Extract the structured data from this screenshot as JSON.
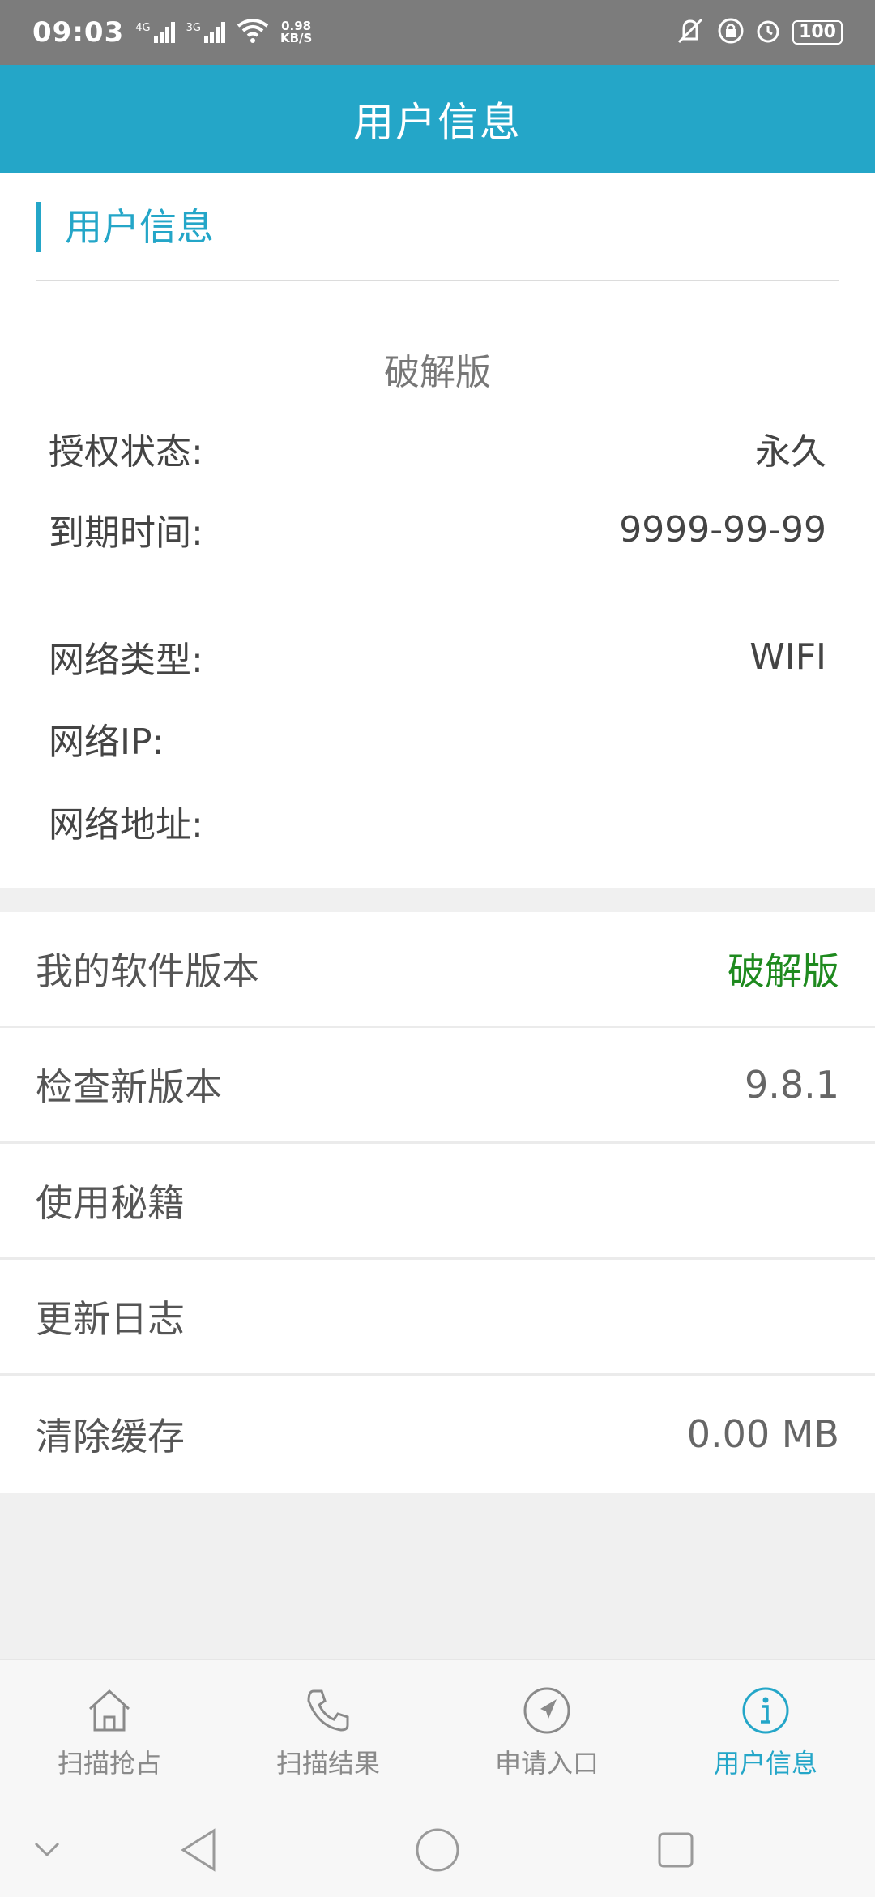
{
  "status_bar": {
    "time": "09:03",
    "sim1": "4G",
    "sim2": "3G",
    "speed_value": "0.98",
    "speed_unit": "KB/S",
    "battery": "100"
  },
  "header": {
    "title": "用户信息"
  },
  "user_info": {
    "section_title": "用户信息",
    "version_label": "破解版",
    "auth_status_label": "授权状态:",
    "auth_status_value": "永久",
    "expiry_label": "到期时间:",
    "expiry_value": "9999-99-99",
    "net_type_label": "网络类型:",
    "net_type_value": "WIFI",
    "net_ip_label": "网络IP:",
    "net_ip_value": "",
    "net_addr_label": "网络地址:",
    "net_addr_value": ""
  },
  "settings": [
    {
      "label": "我的软件版本",
      "value": "破解版"
    },
    {
      "label": "检查新版本",
      "value": "9.8.1"
    },
    {
      "label": "使用秘籍",
      "value": ""
    },
    {
      "label": "更新日志",
      "value": ""
    },
    {
      "label": "清除缓存",
      "value": "0.00 MB"
    }
  ],
  "colors": {
    "accent": "#24a6c8",
    "version_value": "#1f8a1f"
  },
  "bottom_nav": [
    {
      "label": "扫描抢占",
      "icon": "home-icon",
      "active": false
    },
    {
      "label": "扫描结果",
      "icon": "phone-icon",
      "active": false
    },
    {
      "label": "申请入口",
      "icon": "navigation-icon",
      "active": false
    },
    {
      "label": "用户信息",
      "icon": "info-icon",
      "active": true
    }
  ],
  "system_nav": [
    "chevron-down-icon",
    "back-icon",
    "home-circle-icon",
    "recents-icon"
  ]
}
